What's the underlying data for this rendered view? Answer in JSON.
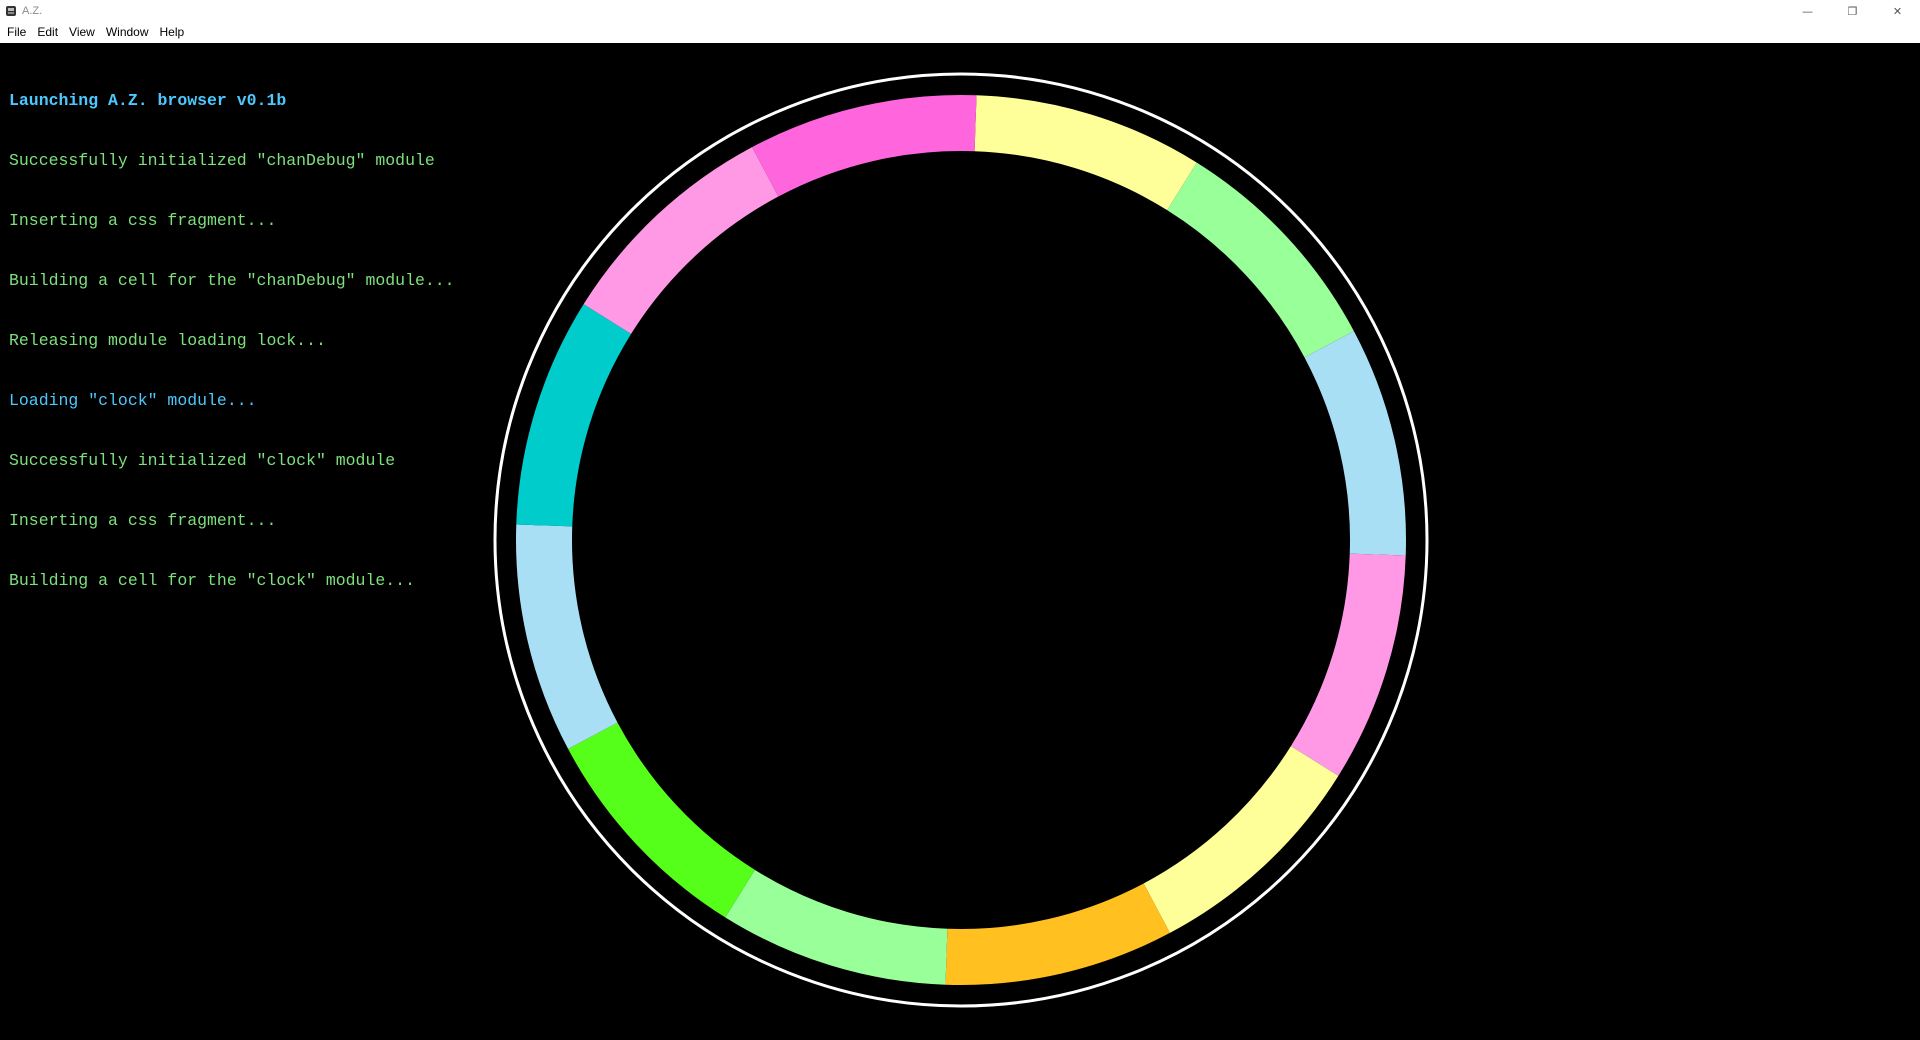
{
  "window": {
    "title": "A.Z.",
    "controls": {
      "minimize_icon": "minimize-icon",
      "restore_icon": "restore-icon",
      "close_icon": "close-icon"
    }
  },
  "menubar": {
    "items": [
      {
        "label": "File"
      },
      {
        "label": "Edit"
      },
      {
        "label": "View"
      },
      {
        "label": "Window"
      },
      {
        "label": "Help"
      }
    ]
  },
  "log": {
    "lines": [
      {
        "text": "Launching A.Z. browser v0.1b",
        "style": "header"
      },
      {
        "text": "Successfully initialized \"chanDebug\" module",
        "style": "normal"
      },
      {
        "text": "Inserting a css fragment...",
        "style": "normal"
      },
      {
        "text": "Building a cell for the \"chanDebug\" module...",
        "style": "normal"
      },
      {
        "text": "Releasing module loading lock...",
        "style": "normal"
      },
      {
        "text": "Loading \"clock\" module...",
        "style": "info"
      },
      {
        "text": "Successfully initialized \"clock\" module",
        "style": "normal"
      },
      {
        "text": "Inserting a css fragment...",
        "style": "normal"
      },
      {
        "text": "Building a cell for the \"clock\" module...",
        "style": "normal"
      }
    ],
    "colors": {
      "header": "#4cc8ff",
      "normal": "#7de07d",
      "info": "#4cc8ff"
    }
  },
  "clock": {
    "ring_outline_color": "#ffffff",
    "segments": [
      {
        "color": "#ffff99"
      },
      {
        "color": "#99ff99"
      },
      {
        "color": "#a8dff5"
      },
      {
        "color": "#ff99e6"
      },
      {
        "color": "#ffff99"
      },
      {
        "color": "#ffc020"
      },
      {
        "color": "#99ff99"
      },
      {
        "color": "#55ff1a"
      },
      {
        "color": "#a8dff5"
      },
      {
        "color": "#00cccc"
      },
      {
        "color": "#ff99e6"
      },
      {
        "color": "#ff66dd"
      }
    ]
  }
}
